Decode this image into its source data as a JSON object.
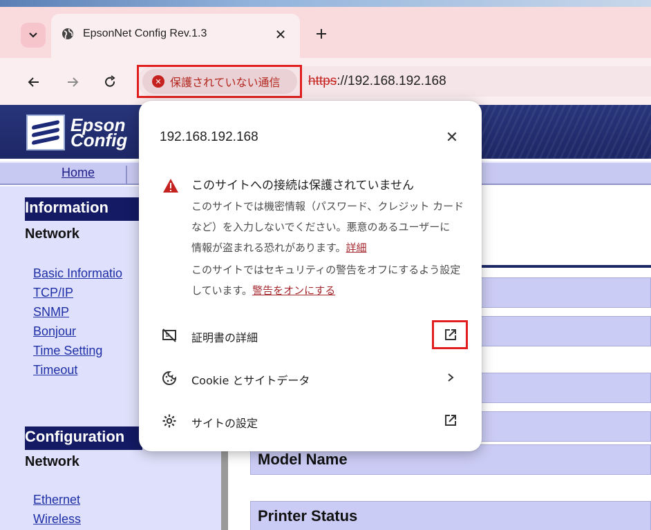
{
  "browser": {
    "tab_title": "EpsonNet Config Rev.1.3",
    "security_chip_label": "保護されていない通信",
    "url_scheme": "https",
    "url_rest": "://192.168.192.168"
  },
  "page": {
    "logo_line1": "Epson",
    "logo_line2": "Config",
    "nav_home": "Home",
    "sidebar": {
      "information_heading": "Information",
      "information_sub": "Network",
      "information_links": [
        "Basic Informatio",
        "TCP/IP",
        "SNMP",
        "Bonjour",
        "Time Setting",
        "Timeout"
      ],
      "configuration_heading": "Configuration",
      "configuration_sub": "Network",
      "configuration_links": [
        "Ethernet",
        "Wireless"
      ]
    },
    "main": {
      "model_name_label": "Model Name",
      "printer_status_label": "Printer Status"
    }
  },
  "popup": {
    "host": "192.168.192.168",
    "warning_title": "このサイトへの接続は保護されていません",
    "warning_line1": "このサイトでは機密情報（パスワード、クレジット カード",
    "warning_line2": "など）を入力しないでください。悪意のあるユーザーに",
    "warning_line3": "情報が盗まれる恐れがあります。",
    "details_link": "詳細",
    "security_off_line1": "このサイトではセキュリティの警告をオフにするよう設定",
    "security_off_line2": "しています。",
    "turn_on_warnings_link": "警告をオンにする",
    "certificate_label": "証明書の詳細",
    "cookie_label": "Cookie とサイトデータ",
    "site_settings_label": "サイトの設定"
  },
  "colors": {
    "highlight_red": "#e11d1d",
    "tab_strip": "#f9dadd",
    "insecure_red": "#c5221f",
    "epson_navy": "#1d2766"
  },
  "icons": [
    "chevron-down-icon",
    "globe-icon",
    "close-icon",
    "plus-icon",
    "back-arrow-icon",
    "forward-arrow-icon",
    "reload-icon",
    "error-circle-icon",
    "warning-triangle-icon",
    "certificate-icon",
    "external-link-icon",
    "cookie-icon",
    "chevron-right-icon",
    "gear-icon"
  ]
}
